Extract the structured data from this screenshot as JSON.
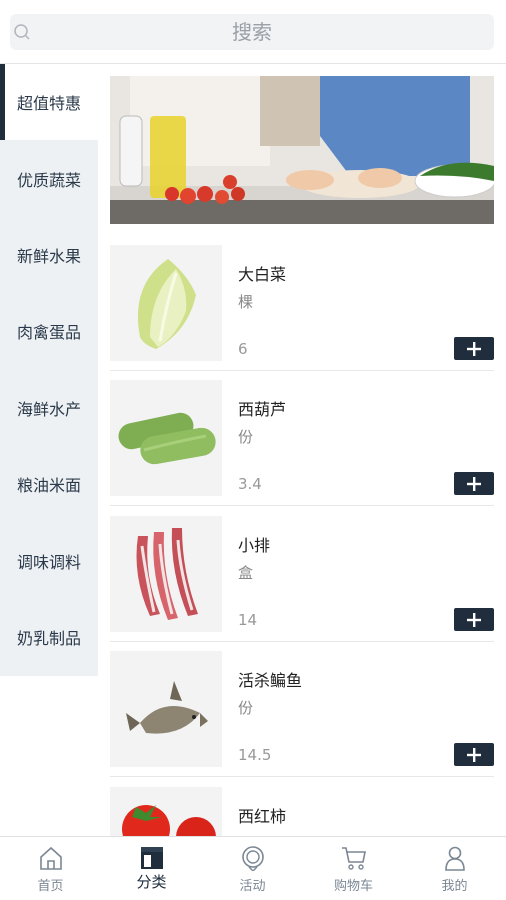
{
  "search": {
    "placeholder": "搜索"
  },
  "sidebar": {
    "items": [
      {
        "label": "超值特惠"
      },
      {
        "label": "优质蔬菜"
      },
      {
        "label": "新鲜水果"
      },
      {
        "label": "肉禽蛋品"
      },
      {
        "label": "海鲜水产"
      },
      {
        "label": "粮油米面"
      },
      {
        "label": "调味调料"
      },
      {
        "label": "奶乳制品"
      }
    ],
    "active_index": 0
  },
  "products": [
    {
      "name": "大白菜",
      "unit": "棵",
      "price": "6",
      "image": "napa-cabbage"
    },
    {
      "name": "西葫芦",
      "unit": "份",
      "price": "3.4",
      "image": "zucchini"
    },
    {
      "name": "小排",
      "unit": "盒",
      "price": "14",
      "image": "pork-ribs"
    },
    {
      "name": "活杀鳊鱼",
      "unit": "份",
      "price": "14.5",
      "image": "bream-fish"
    },
    {
      "name": "西红柿",
      "unit": "",
      "price": "",
      "image": "tomato"
    }
  ],
  "tabbar": {
    "items": [
      {
        "label": "首页",
        "icon": "home-icon"
      },
      {
        "label": "分类",
        "icon": "category-icon"
      },
      {
        "label": "活动",
        "icon": "activity-icon"
      },
      {
        "label": "购物车",
        "icon": "cart-icon"
      },
      {
        "label": "我的",
        "icon": "user-icon"
      }
    ],
    "active_index": 1
  },
  "colors": {
    "accent": "#1f2d3d",
    "sidebar_bg": "#eef1f4",
    "muted": "#888888"
  }
}
